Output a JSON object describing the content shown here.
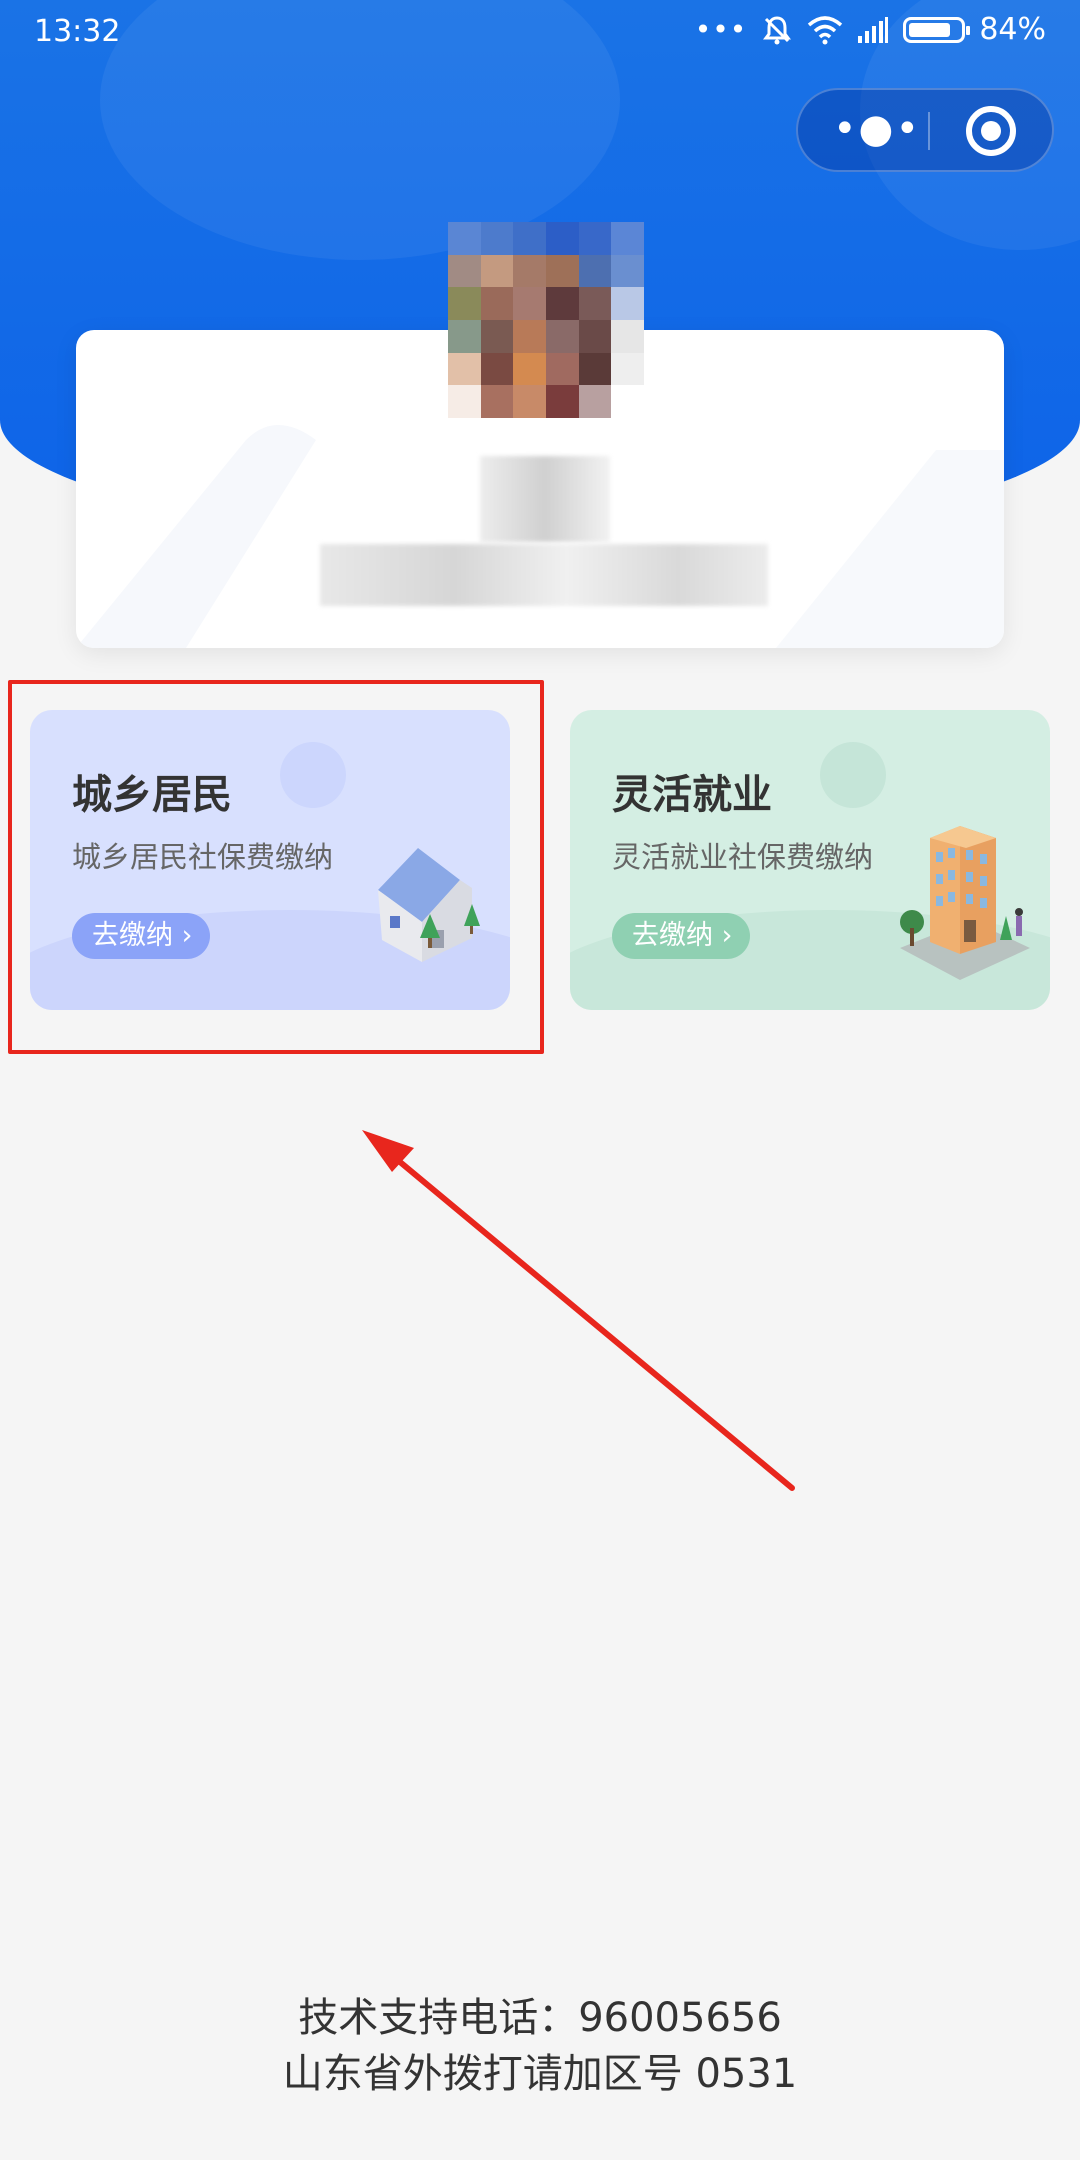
{
  "status_bar": {
    "time": "13:32",
    "battery": "84%",
    "battery_level": 0.84,
    "icons": [
      "more-dots-icon",
      "bell-muted-icon",
      "wifi-icon",
      "signal-icon",
      "battery-icon"
    ]
  },
  "capsule": {
    "more_icon": "more-dots-icon",
    "close_icon": "target-icon"
  },
  "cards": [
    {
      "title": "城乡居民",
      "subtitle": "城乡居民社保费缴纳",
      "button": "去缴纳",
      "illustration": "house-icon",
      "bg_color": "#d8e0fe",
      "btn_color": "#8ba3f8"
    },
    {
      "title": "灵活就业",
      "subtitle": "灵活就业社保费缴纳",
      "button": "去缴纳",
      "illustration": "building-icon",
      "bg_color": "#d4eee3",
      "btn_color": "#8fd0b2"
    }
  ],
  "footer": {
    "line1": "技术支持电话：96005656",
    "line2": "山东省外拨打请加区号 0531"
  },
  "colors": {
    "header_blue": "#0d63e8",
    "page_bg": "#f5f5f5",
    "annotation_red": "#e8261d"
  }
}
